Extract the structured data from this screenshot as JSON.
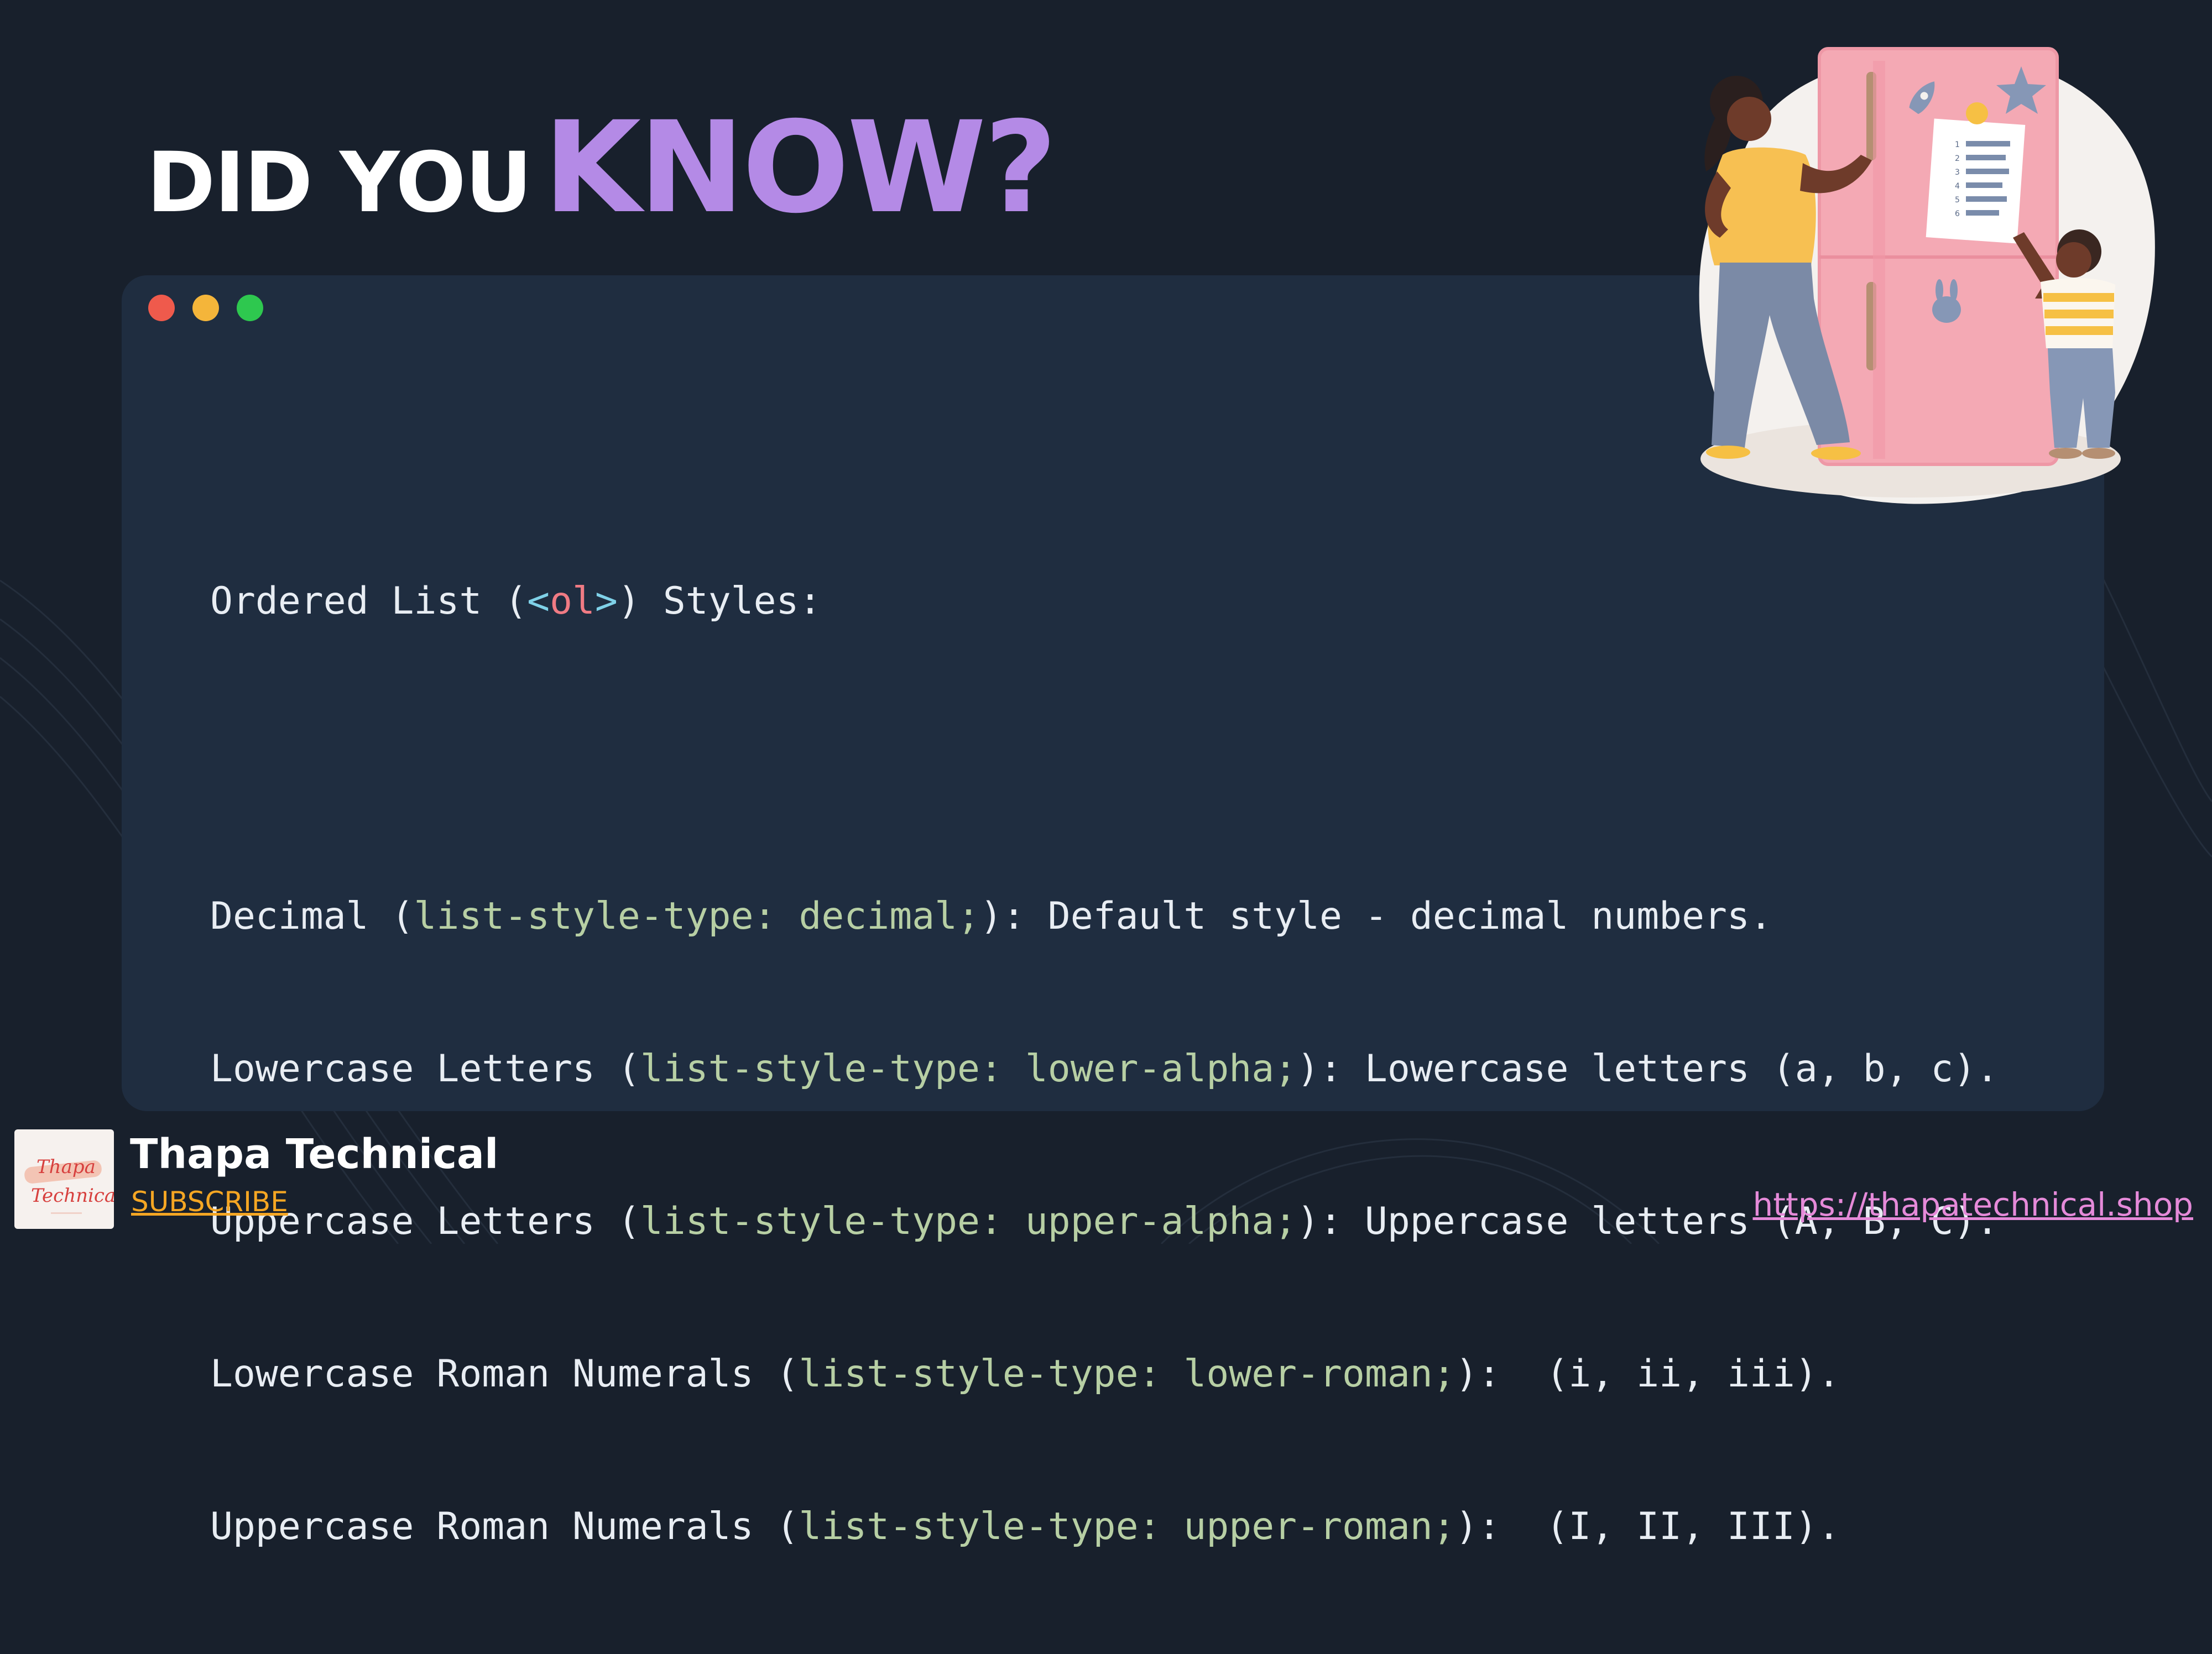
{
  "headline": {
    "part1": "DID YOU",
    "part2": "KNOW?"
  },
  "colors": {
    "background": "#18202c",
    "panel": "#1f2d40",
    "accent_purple": "#b48ae6",
    "code_property": "#b7cfa4",
    "subscribe": "#f5a623",
    "url": "#e58ad9"
  },
  "window_controls": [
    "close-dot",
    "minimize-dot",
    "maximize-dot"
  ],
  "code": {
    "title": {
      "before": "Ordered List (",
      "lt": "<",
      "tag": "ol",
      "gt": ">",
      "after": ") Styles:"
    },
    "lines": [
      {
        "name": "Decimal (",
        "prop": "list-style-type: decimal;",
        "desc": "): Default style - decimal numbers."
      },
      {
        "name": "Lowercase Letters (",
        "prop": "list-style-type: lower-alpha;",
        "desc": "): Lowercase letters (a, b, c)."
      },
      {
        "name": "Uppercase Letters (",
        "prop": "list-style-type: upper-alpha;",
        "desc": "): Uppercase letters (A, B, C)."
      },
      {
        "name": "Lowercase Roman Numerals (",
        "prop": "list-style-type: lower-roman;",
        "desc": "):  (i, ii, iii)."
      },
      {
        "name": "Uppercase Roman Numerals (",
        "prop": "list-style-type: upper-roman;",
        "desc": "):  (I, II, III)."
      }
    ]
  },
  "illustration": {
    "chart_numbers": [
      "1",
      "2",
      "3",
      "4",
      "5",
      "6"
    ]
  },
  "footer": {
    "logo_line1": "Thapa",
    "logo_line2": "Technical",
    "brand": "Thapa Technical",
    "subscribe": "SUBSCRIBE",
    "url": "https://thapatechnical.shop"
  }
}
